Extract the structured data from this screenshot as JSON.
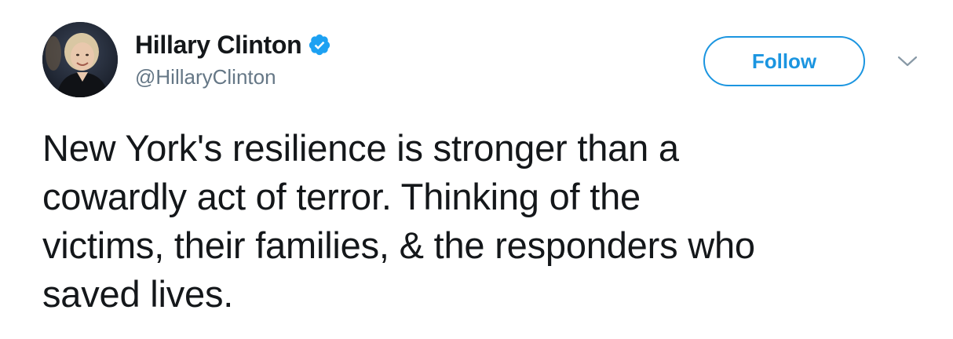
{
  "tweet": {
    "author": {
      "display_name": "Hillary Clinton",
      "handle": "@HillaryClinton",
      "verified": true,
      "avatar_icon": "profile-photo"
    },
    "follow_label": "Follow",
    "menu_icon": "chevron-down-icon",
    "text": "New York's resilience is stronger than a\ncowardly act of terror. Thinking of the\nvictims, their families, & the responders who\nsaved lives."
  },
  "colors": {
    "accent": "#1b95e0",
    "text": "#14171a",
    "secondary_text": "#657786",
    "verified_badge": "#1da1f2"
  }
}
